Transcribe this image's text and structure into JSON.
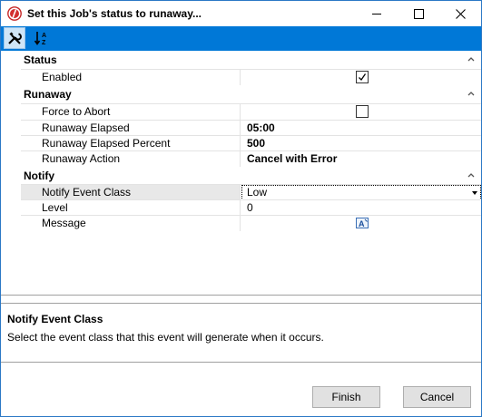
{
  "window": {
    "title": "Set this Job's status to runaway...",
    "icon": "app-logo-icon"
  },
  "toolbar": {
    "buttons": [
      {
        "name": "properties-tools",
        "icon": "wrench-screwdriver-icon"
      },
      {
        "name": "sort-ascending",
        "icon": "sort-az-icon"
      }
    ]
  },
  "categories": {
    "status": {
      "label": "Status",
      "rows": [
        {
          "name": "Enabled",
          "value_type": "checkbox",
          "checked": true
        }
      ]
    },
    "runaway": {
      "label": "Runaway",
      "rows": [
        {
          "name": "Force to Abort",
          "value_type": "checkbox",
          "checked": false
        },
        {
          "name": "Runaway Elapsed",
          "value": "05:00"
        },
        {
          "name": "Runaway Elapsed Percent",
          "value": "500"
        },
        {
          "name": "Runaway Action",
          "value": "Cancel with Error"
        }
      ]
    },
    "notify": {
      "label": "Notify",
      "rows": [
        {
          "name": "Notify Event Class",
          "value": "Low",
          "value_type": "select"
        },
        {
          "name": "Level",
          "value": "0"
        },
        {
          "name": "Message",
          "value_type": "editor"
        }
      ]
    }
  },
  "description": {
    "title": "Notify Event Class",
    "text": "Select the event class that this event will generate when it occurs."
  },
  "footer": {
    "finish_label": "Finish",
    "cancel_label": "Cancel"
  },
  "colors": {
    "toolbar": "#0078d7",
    "border": "#2b78c5"
  }
}
